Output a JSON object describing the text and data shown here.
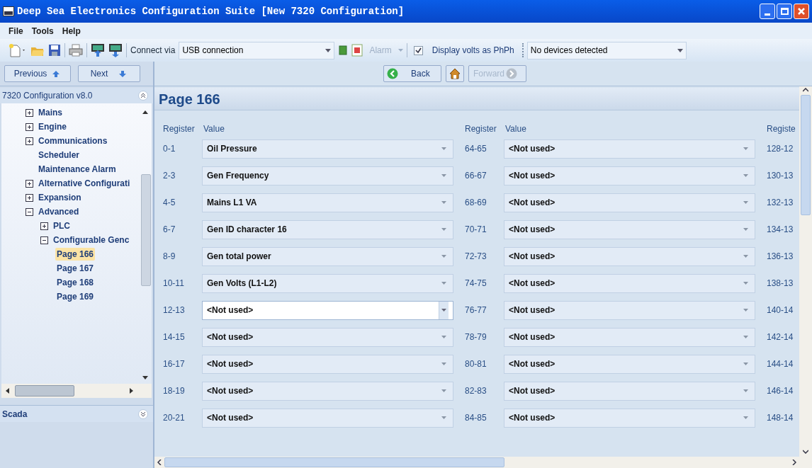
{
  "window": {
    "title": "Deep Sea Electronics Configuration Suite [New 7320 Configuration]"
  },
  "menu": [
    "File",
    "Tools",
    "Help"
  ],
  "toolbar": {
    "connect_label": "Connect via",
    "connect_value": "USB connection",
    "alarm": {
      "label": "Alarm",
      "disabled": true
    },
    "volts_checkbox": {
      "label": "Display volts as PhPh",
      "checked": true
    },
    "device_value": "No devices detected"
  },
  "nav": {
    "previous": "Previous",
    "next": "Next",
    "back": "Back",
    "forward": {
      "label": "Forward",
      "disabled": true
    }
  },
  "sidebar": {
    "title": "7320 Configuration v8.0",
    "items": [
      {
        "label": "Mains",
        "kind": "group",
        "expanded": false,
        "selected": false
      },
      {
        "label": "Engine",
        "kind": "group",
        "expanded": false,
        "selected": false
      },
      {
        "label": "Communications",
        "kind": "group",
        "expanded": false,
        "selected": false
      },
      {
        "label": "Scheduler",
        "kind": "leaf",
        "selected": false
      },
      {
        "label": "Maintenance Alarm",
        "kind": "leaf",
        "selected": false
      },
      {
        "label": "Alternative Configurati",
        "kind": "group",
        "expanded": false,
        "selected": false
      },
      {
        "label": "Expansion",
        "kind": "group",
        "expanded": false,
        "selected": false
      },
      {
        "label": "Advanced",
        "kind": "group",
        "expanded": true,
        "selected": false,
        "children": [
          {
            "label": "PLC",
            "kind": "group",
            "expanded": false,
            "selected": false
          },
          {
            "label": "Configurable Genc",
            "kind": "group",
            "expanded": true,
            "selected": false,
            "children": [
              {
                "label": "Page 166",
                "kind": "leaf",
                "selected": true
              },
              {
                "label": "Page 167",
                "kind": "leaf",
                "selected": false
              },
              {
                "label": "Page 168",
                "kind": "leaf",
                "selected": false
              },
              {
                "label": "Page 169",
                "kind": "leaf",
                "selected": false
              }
            ]
          }
        ]
      }
    ],
    "scada_title": "Scada"
  },
  "page": {
    "title": "Page 166",
    "columns": [
      {
        "register_header": "Register",
        "value_header": "Value",
        "rows": [
          {
            "register": "0-1",
            "value": "Oil Pressure",
            "selected": false
          },
          {
            "register": "2-3",
            "value": "Gen Frequency",
            "selected": false
          },
          {
            "register": "4-5",
            "value": "Mains L1 VA",
            "selected": false
          },
          {
            "register": "6-7",
            "value": "Gen ID character 16",
            "selected": false
          },
          {
            "register": "8-9",
            "value": "Gen total power",
            "selected": false
          },
          {
            "register": "10-11",
            "value": "Gen Volts (L1-L2)",
            "selected": false
          },
          {
            "register": "12-13",
            "value": "<Not used>",
            "selected": true
          },
          {
            "register": "14-15",
            "value": "<Not used>",
            "selected": false
          },
          {
            "register": "16-17",
            "value": "<Not used>",
            "selected": false
          },
          {
            "register": "18-19",
            "value": "<Not used>",
            "selected": false
          },
          {
            "register": "20-21",
            "value": "<Not used>",
            "selected": false
          }
        ]
      },
      {
        "register_header": "Register",
        "value_header": "Value",
        "rows": [
          {
            "register": "64-65",
            "value": "<Not used>",
            "selected": false
          },
          {
            "register": "66-67",
            "value": "<Not used>",
            "selected": false
          },
          {
            "register": "68-69",
            "value": "<Not used>",
            "selected": false
          },
          {
            "register": "70-71",
            "value": "<Not used>",
            "selected": false
          },
          {
            "register": "72-73",
            "value": "<Not used>",
            "selected": false
          },
          {
            "register": "74-75",
            "value": "<Not used>",
            "selected": false
          },
          {
            "register": "76-77",
            "value": "<Not used>",
            "selected": false
          },
          {
            "register": "78-79",
            "value": "<Not used>",
            "selected": false
          },
          {
            "register": "80-81",
            "value": "<Not used>",
            "selected": false
          },
          {
            "register": "82-83",
            "value": "<Not used>",
            "selected": false
          },
          {
            "register": "84-85",
            "value": "<Not used>",
            "selected": false
          }
        ]
      },
      {
        "register_header": "Registe",
        "rows": [
          {
            "register": "128-12"
          },
          {
            "register": "130-13"
          },
          {
            "register": "132-13"
          },
          {
            "register": "134-13"
          },
          {
            "register": "136-13"
          },
          {
            "register": "138-13"
          },
          {
            "register": "140-14"
          },
          {
            "register": "142-14"
          },
          {
            "register": "144-14"
          },
          {
            "register": "146-14"
          },
          {
            "register": "148-14"
          }
        ]
      }
    ]
  }
}
